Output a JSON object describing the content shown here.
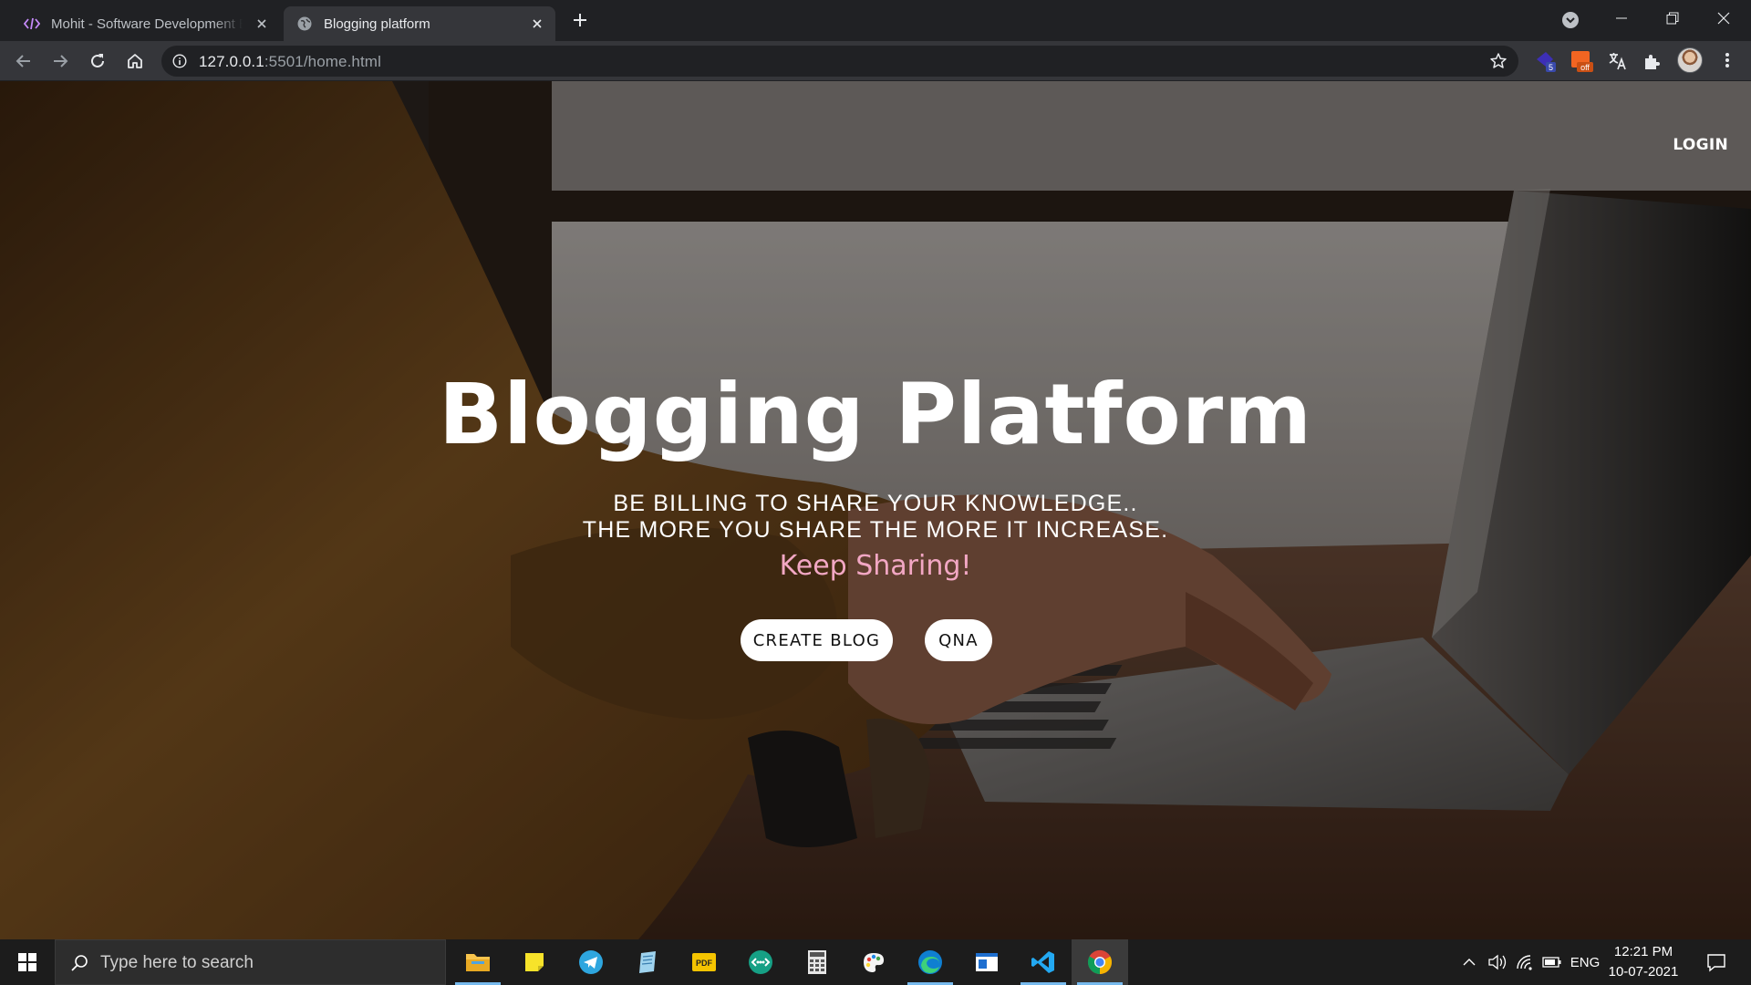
{
  "browser": {
    "tabs": [
      {
        "title": "Mohit - Software Development E",
        "favicon": "code-icon",
        "active": false
      },
      {
        "title": "Blogging platform",
        "favicon": "globe-icon",
        "active": true
      }
    ],
    "url_host": "127.0.0.1",
    "url_rest": ":5501/home.html",
    "extension_badges": {
      "ext1": "5",
      "ext2": "off"
    }
  },
  "page": {
    "nav": {
      "login_label": "LOGIN"
    },
    "hero": {
      "title": "Blogging Platform",
      "subtitle_line1": "BE BILLING TO SHARE YOUR KNOWLEDGE..",
      "subtitle_line2": "THE MORE YOU SHARE THE MORE IT INCREASE.",
      "tagline": "Keep Sharing!"
    },
    "buttons": {
      "create_blog": "CREATE BLOG",
      "qna": "QNA"
    },
    "colors": {
      "tagline": "#f2a7c4",
      "button_bg": "#ffffff"
    }
  },
  "taskbar": {
    "search_placeholder": "Type here to search",
    "language": "ENG",
    "time": "12:21 PM",
    "date": "10-07-2021",
    "apps": [
      "file-explorer-icon",
      "sticky-notes-icon",
      "telegram-icon",
      "notepad-icon",
      "pdf-icon",
      "connect-icon",
      "calculator-icon",
      "paint-icon",
      "edge-icon",
      "window-icon",
      "vscode-icon",
      "chrome-icon"
    ]
  }
}
